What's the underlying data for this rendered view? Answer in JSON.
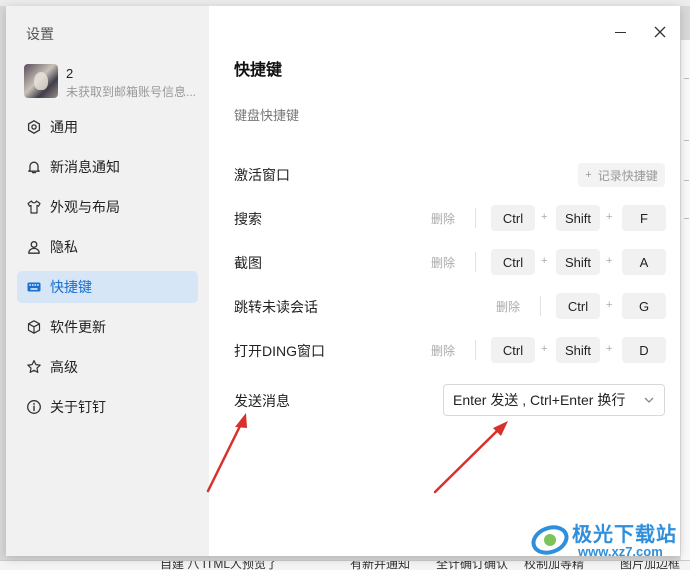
{
  "background": {
    "bottom_fragments": [
      "自建 八 ITML人预览了",
      "有新并通知",
      "全计确订确认",
      "校制加等精",
      "图片加边框"
    ]
  },
  "sidebar": {
    "title": "设置",
    "profile": {
      "name": "2",
      "subtitle": "未获取到邮箱账号信息..."
    },
    "items": [
      {
        "label": "通用",
        "icon": "gear-icon"
      },
      {
        "label": "新消息通知",
        "icon": "bell-icon"
      },
      {
        "label": "外观与布局",
        "icon": "shirt-icon"
      },
      {
        "label": "隐私",
        "icon": "user-icon"
      },
      {
        "label": "快捷键",
        "icon": "keyboard-icon",
        "active": true
      },
      {
        "label": "软件更新",
        "icon": "cube-icon"
      },
      {
        "label": "高级",
        "icon": "star-icon"
      },
      {
        "label": "关于钉钉",
        "icon": "info-icon"
      }
    ]
  },
  "content": {
    "title": "快捷键",
    "subtitle": "键盘快捷键",
    "rows": [
      {
        "label": "激活窗口",
        "record_label": "记录快捷键",
        "record_plus": "+"
      },
      {
        "label": "搜索",
        "delete": "删除",
        "keys": [
          "Ctrl",
          "Shift",
          "F"
        ]
      },
      {
        "label": "截图",
        "delete": "删除",
        "keys": [
          "Ctrl",
          "Shift",
          "A"
        ]
      },
      {
        "label": "跳转未读会话",
        "delete": "删除",
        "keys": [
          "Ctrl",
          "G"
        ]
      },
      {
        "label": "打开DING窗口",
        "delete": "删除",
        "keys": [
          "Ctrl",
          "Shift",
          "D"
        ]
      }
    ],
    "plus_sign": "+",
    "send": {
      "label": "发送消息",
      "selected": "Enter 发送 , Ctrl+Enter 换行"
    }
  },
  "window": {
    "minimize_icon": "minimize-icon",
    "close_icon": "close-icon"
  },
  "watermark": {
    "line1": "极光下载站",
    "line2": "www.xz7.com"
  },
  "colors": {
    "accent": "#1a6fd1",
    "active_bg": "#d6e6f6",
    "sidebar_bg": "#f1f1f1",
    "arrow": "#d9302c",
    "watermark": "#2e8fdc"
  }
}
